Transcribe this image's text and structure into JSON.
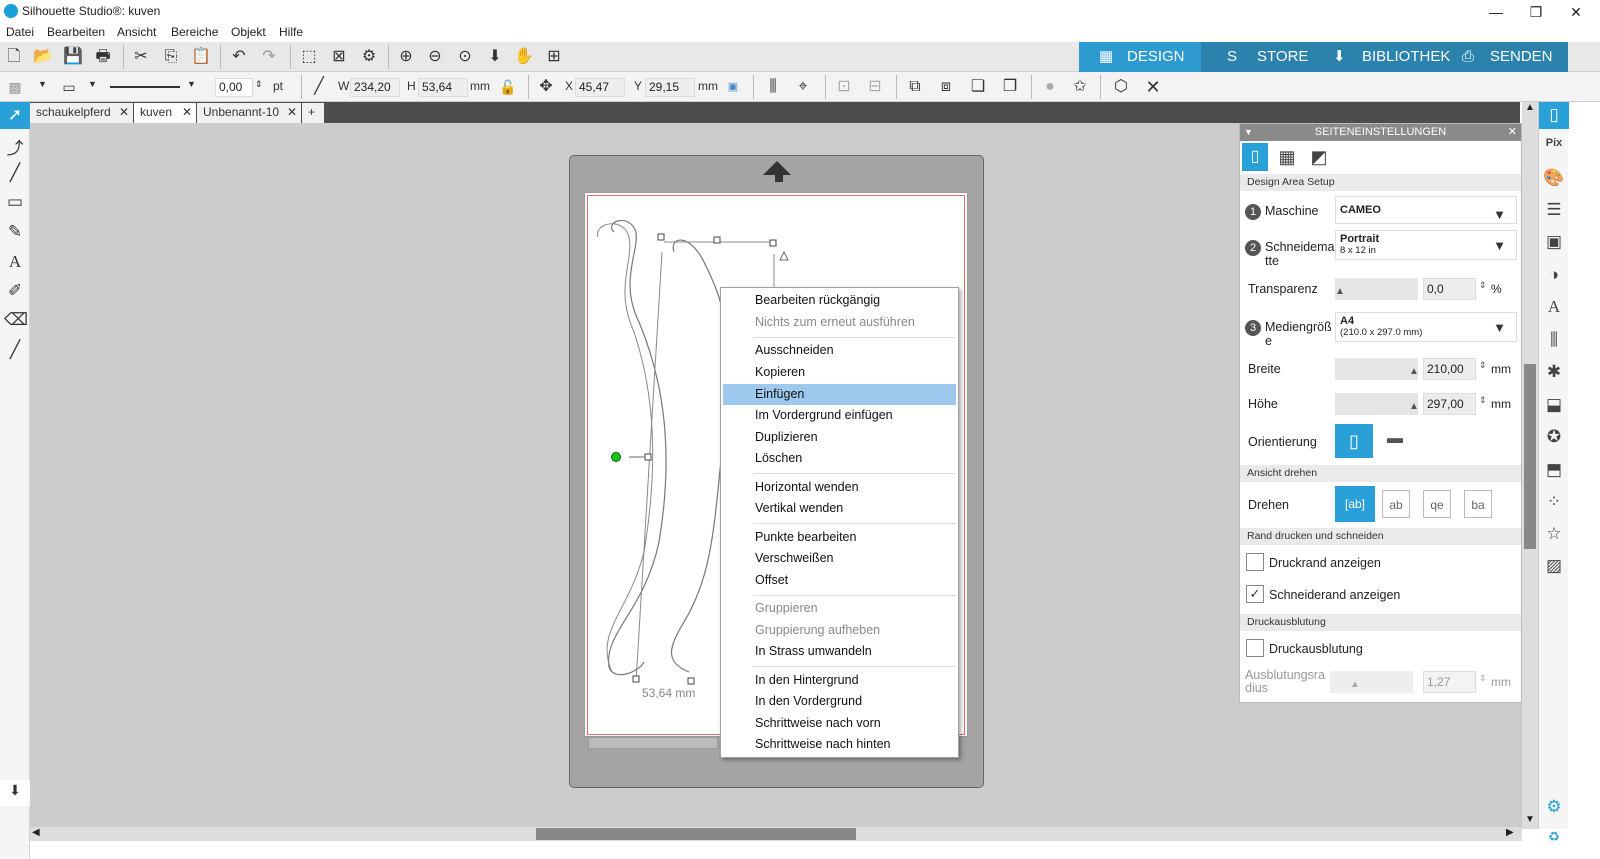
{
  "window": {
    "title": "Silhouette Studio®: kuven"
  },
  "menu": [
    "Datei",
    "Bearbeiten",
    "Ansicht",
    "Bereiche",
    "Objekt",
    "Hilfe"
  ],
  "nav_tabs": [
    {
      "label": "DESIGN",
      "icon": "grid-icon"
    },
    {
      "label": "STORE",
      "icon": "store-icon"
    },
    {
      "label": "BIBLIOTHEK",
      "icon": "library-icon"
    },
    {
      "label": "SENDEN",
      "icon": "send-icon"
    }
  ],
  "toolbar2": {
    "line_width": "0,00",
    "line_unit": "pt",
    "w_label": "W",
    "w_value": "234,20",
    "h_label": "H",
    "h_value": "53,64",
    "size_unit": "mm",
    "x_label": "X",
    "x_value": "45,47",
    "y_label": "Y",
    "y_value": "29,15",
    "pos_unit": "mm"
  },
  "doc_tabs": [
    "schaukelpferd",
    "kuven",
    "Unbenannt-10"
  ],
  "canvas": {
    "dimension_label": "53,64 mm"
  },
  "context_menu": {
    "items": [
      {
        "label": "Bearbeiten rückgängig",
        "state": "normal"
      },
      {
        "label": "Nichts zum erneut ausführen",
        "state": "disabled"
      },
      {
        "label": "Ausschneiden",
        "state": "normal"
      },
      {
        "label": "Kopieren",
        "state": "normal"
      },
      {
        "label": "Einfügen",
        "state": "highlighted"
      },
      {
        "label": "Im Vordergrund einfügen",
        "state": "normal"
      },
      {
        "label": "Duplizieren",
        "state": "normal"
      },
      {
        "label": "Löschen",
        "state": "normal"
      },
      {
        "label": "Horizontal wenden",
        "state": "normal"
      },
      {
        "label": "Vertikal wenden",
        "state": "normal"
      },
      {
        "label": "Punkte bearbeiten",
        "state": "normal"
      },
      {
        "label": "Verschweißen",
        "state": "normal"
      },
      {
        "label": "Offset",
        "state": "normal"
      },
      {
        "label": "Gruppieren",
        "state": "disabled"
      },
      {
        "label": "Gruppierung aufheben",
        "state": "disabled"
      },
      {
        "label": "In Strass umwandeln",
        "state": "normal"
      },
      {
        "label": "In den Hintergrund",
        "state": "normal"
      },
      {
        "label": "In den Vordergrund",
        "state": "normal"
      },
      {
        "label": "Schrittweise nach vorn",
        "state": "normal"
      },
      {
        "label": "Schrittweise nach hinten",
        "state": "normal"
      }
    ]
  },
  "panel": {
    "title": "SEITENEINSTELLUNGEN",
    "design_area": "Design Area Setup",
    "maschine_label": "Maschine",
    "maschine_value": "CAMEO",
    "schneidematte_label": "Schneidematte",
    "schneidematte_value": "Portrait",
    "schneidematte_sub": "8 x 12 in",
    "transparenz_label": "Transparenz",
    "transparenz_value": "0,0",
    "transparenz_unit": "%",
    "mediengroesse_label": "Mediengröße",
    "mediengroesse_value": "A4",
    "mediengroesse_sub": "(210.0 x 297.0 mm)",
    "breite_label": "Breite",
    "breite_value": "210,00",
    "breite_unit": "mm",
    "hoehe_label": "Höhe",
    "hoehe_value": "297,00",
    "hoehe_unit": "mm",
    "orientierung_label": "Orientierung",
    "ansicht_drehen": "Ansicht drehen",
    "drehen_label": "Drehen",
    "rand_section": "Rand drucken und schneiden",
    "druckrand_label": "Druckrand anzeigen",
    "druckrand_checked": false,
    "schneiderand_label": "Schneiderand anzeigen",
    "schneiderand_checked": true,
    "druckausblutung_section": "Druckausblutung",
    "druckausblutung_label": "Druckausblutung",
    "druckausblutung_checked": false,
    "ausblutung_label": "Ausblutungsradius",
    "ausblutung_value": "1,27",
    "ausblutung_unit": "mm"
  },
  "colors": {
    "accent": "#1aa4db",
    "nav_bg": "#2e93c2",
    "selection": "#9ec9ef"
  }
}
